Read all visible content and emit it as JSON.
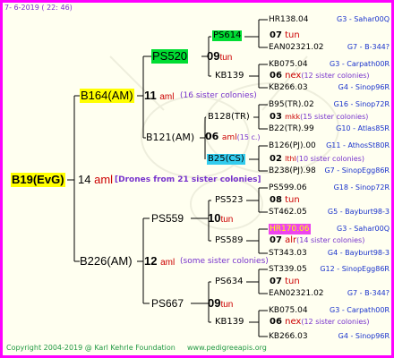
{
  "header": {
    "date": "7-  6-2019 ( 22: 46)"
  },
  "footer": {
    "copyright": "Copyright 2004-2019 @ Karl Kehrle Foundation",
    "url": "www.pedigreeapis.org"
  },
  "root": {
    "label": "B19(EvG)",
    "gen": "14",
    "mark": "aml",
    "note": "[Drones from 21 sister colonies]"
  },
  "b164": {
    "label": "B164(AM)",
    "gen": "11",
    "mark": "aml",
    "note": "(16 sister colonies)"
  },
  "b226": {
    "label": "B226(AM)",
    "gen": "12",
    "mark": "aml",
    "note": "(some sister colonies)"
  },
  "ps520": {
    "label": "PS520",
    "gen": "09",
    "mark": "tun"
  },
  "b121": {
    "label": "B121(AM)",
    "gen": "06",
    "mark": "aml",
    "note": "(15 c.)"
  },
  "ps559": {
    "label": "PS559",
    "gen": "10",
    "mark": "tun"
  },
  "ps667": {
    "label": "PS667",
    "gen": "09",
    "mark": "tun"
  },
  "g4": [
    {
      "label": "PS614",
      "gen": "07",
      "mark": "tun"
    },
    {
      "label": "KB139",
      "gen": "06",
      "mark": "nex",
      "note": "(12 sister colonies)"
    },
    {
      "label": "B128(TR)",
      "gen": "03",
      "mark": "mkk",
      "note": "(15 sister colonies)"
    },
    {
      "label": "B25(CS)",
      "gen": "02",
      "mark": "lthl",
      "note": "(10 sister colonies)"
    },
    {
      "label": "PS523",
      "gen": "08",
      "mark": "tun"
    },
    {
      "label": "PS589",
      "gen": "07",
      "mark": "alr",
      "note": "(14 sister colonies)"
    },
    {
      "label": "PS634",
      "gen": "07",
      "mark": "tun"
    },
    {
      "label": "KB139",
      "gen": "06",
      "mark": "nex",
      "note": "(12 sister colonies)"
    }
  ],
  "g5": [
    {
      "id": "HR138.04",
      "anc": "G3 - Sahar00Q"
    },
    {
      "id": "EAN02321.02",
      "anc": "G7 - B-344?"
    },
    {
      "id": "KB075.04",
      "anc": "G3 - Carpath00R"
    },
    {
      "id": "KB266.03",
      "anc": "G4 - Sinop96R"
    },
    {
      "id": "B95(TR).02",
      "anc": "G16 - Sinop72R"
    },
    {
      "id": "B22(TR).99",
      "anc": "G10 - Atlas85R"
    },
    {
      "id": "B126(PJ).00",
      "anc": "G11 - AthosSt80R"
    },
    {
      "id": "B238(PJ).98",
      "anc": "G7 - SinopEgg86R"
    },
    {
      "id": "PS599.06",
      "anc": "G18 - Sinop72R"
    },
    {
      "id": "ST462.05",
      "anc": "G5 - Bayburt98-3"
    },
    {
      "id": "HR170.06",
      "anc": "G3 - Sahar00Q"
    },
    {
      "id": "ST343.03",
      "anc": "G4 - Bayburt98-3"
    },
    {
      "id": "ST339.05",
      "anc": "G12 - SinopEgg86R"
    },
    {
      "id": "EAN02321.02",
      "anc": "G7 - B-344?"
    },
    {
      "id": "KB075.04",
      "anc": "G3 - Carpath00R"
    },
    {
      "id": "KB266.03",
      "anc": "G4 - Sinop96R"
    }
  ],
  "colors": {
    "frame": "#ff00ff",
    "root_box": "#ffff00",
    "b164_box": "#ffff00",
    "ps520_box": "#00dd33",
    "ps614_box": "#00dd33",
    "b25_box": "#33ccee",
    "hr170_box": "#ee44ee"
  }
}
